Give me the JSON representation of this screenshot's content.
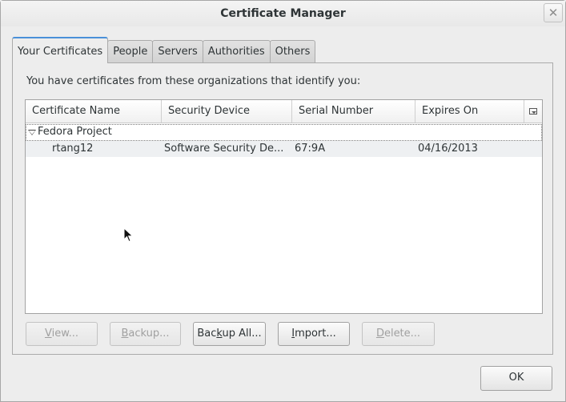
{
  "window": {
    "title": "Certificate Manager",
    "close_glyph": "✕"
  },
  "tabs": [
    {
      "label": "Your Certificates",
      "active": true
    },
    {
      "label": "People",
      "active": false
    },
    {
      "label": "Servers",
      "active": false
    },
    {
      "label": "Authorities",
      "active": false
    },
    {
      "label": "Others",
      "active": false
    }
  ],
  "intro_text": "You have certificates from these organizations that identify you:",
  "table": {
    "columns": [
      "Certificate Name",
      "Security Device",
      "Serial Number",
      "Expires On"
    ],
    "groups": [
      {
        "name": "Fedora Project",
        "expanded": true,
        "rows": [
          {
            "name": "rtang12",
            "device": "Software Security De...",
            "serial": "67:9A",
            "expires": "04/16/2013"
          }
        ]
      }
    ]
  },
  "buttons": {
    "view": {
      "pre": "",
      "mn": "V",
      "post": "iew..."
    },
    "backup": {
      "pre": "",
      "mn": "B",
      "post": "ackup..."
    },
    "backup_all": {
      "pre": "Bac",
      "mn": "k",
      "post": "up All..."
    },
    "import": {
      "pre": "",
      "mn": "I",
      "post": "mport..."
    },
    "delete": {
      "pre": "",
      "mn": "D",
      "post": "elete..."
    },
    "ok": "OK"
  },
  "icons": {
    "column_picker": "column-picker-icon",
    "expander": "expander-open-icon",
    "cursor": "mouse-pointer-icon"
  }
}
